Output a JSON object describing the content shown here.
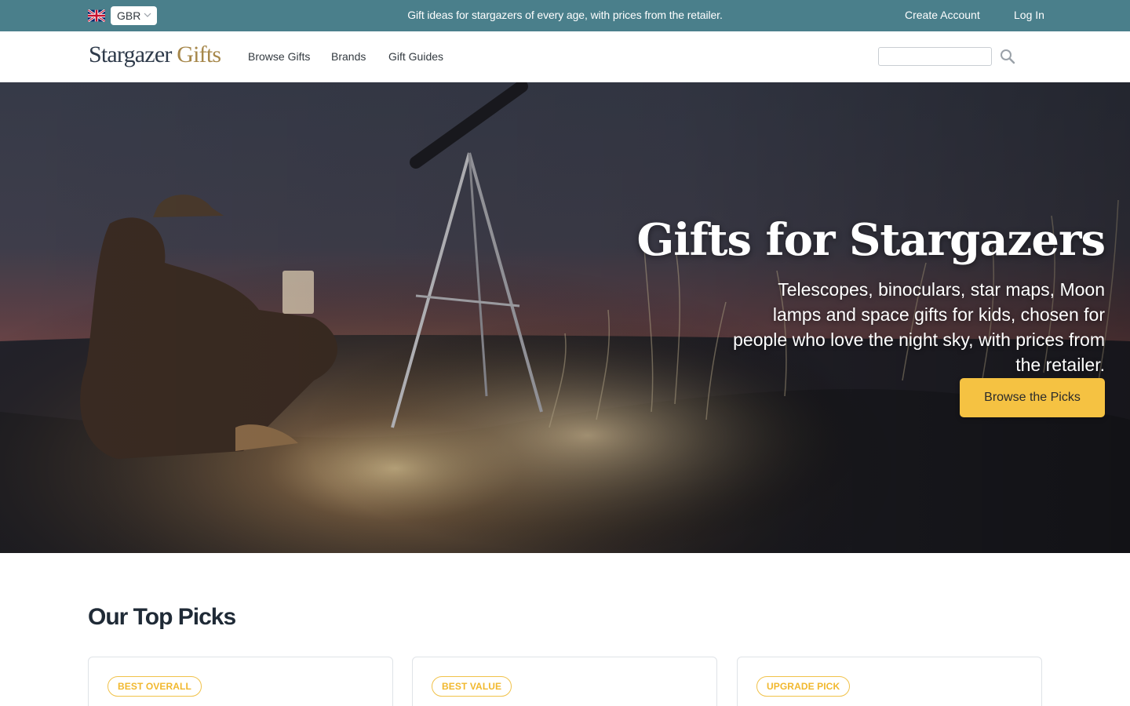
{
  "topbar": {
    "region_code": "GBR",
    "region_flag_icon": "uk-flag-icon",
    "message": "Gift ideas for stargazers of every age, with prices from the retailer.",
    "create_account": "Create Account",
    "log_in": "Log In",
    "background_color": "#4a7f8b"
  },
  "header": {
    "logo_part1": "Stargazer",
    "logo_part2": "Gifts",
    "nav": {
      "browse": "Browse Gifts",
      "brands": "Brands",
      "guides": "Gift Guides"
    },
    "search_placeholder": "",
    "search_icon": "search-icon"
  },
  "hero": {
    "title": "Gifts for Stargazers",
    "subtitle": "Telescopes, binoculars, star maps, Moon lamps and space gifts for kids, chosen for people who love the night sky, with prices from the retailer.",
    "cta": "Browse the Picks",
    "cta_color": "#f5c242"
  },
  "top_picks": {
    "heading": "Our Top Picks",
    "cards": [
      {
        "badge": "BEST OVERALL"
      },
      {
        "badge": "BEST VALUE"
      },
      {
        "badge": "UPGRADE PICK"
      }
    ],
    "badge_color": "#f1c24a"
  }
}
